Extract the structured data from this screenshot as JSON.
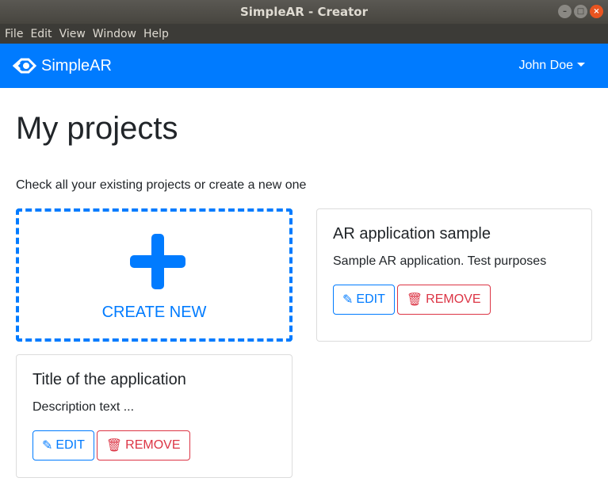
{
  "window": {
    "title": "SimpleAR - Creator"
  },
  "menu": [
    "File",
    "Edit",
    "View",
    "Window",
    "Help"
  ],
  "navbar": {
    "brand": "SimpleAR",
    "user": "John Doe"
  },
  "page": {
    "title": "My projects",
    "lead": "Check all your existing projects or create a new one",
    "create_label": "CREATE NEW"
  },
  "projects": [
    {
      "title": "AR application sample",
      "description": "Sample AR application. Test purposes",
      "edit": "EDIT",
      "remove": "REMOVE"
    },
    {
      "title": "Title of the application",
      "description": "Description text ...",
      "edit": "EDIT",
      "remove": "REMOVE"
    }
  ]
}
